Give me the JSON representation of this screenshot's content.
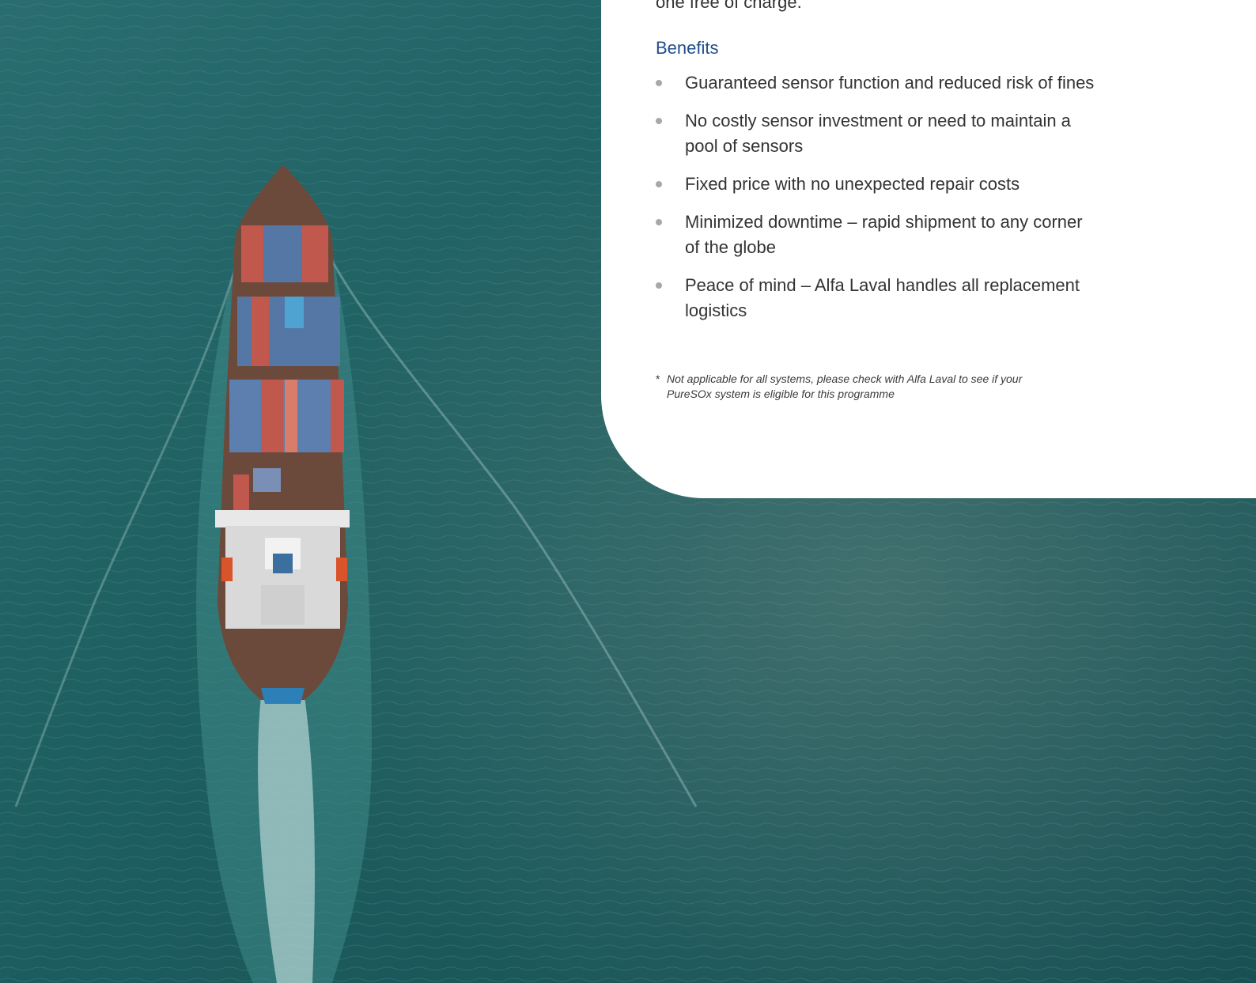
{
  "photo": {
    "subject": "container-ship-aerial"
  },
  "colors": {
    "sea": "#1d5e60",
    "card": "#ffffff",
    "heading": "#1f4e8c",
    "body_text": "#333333",
    "bullet": "#a7a8aa"
  },
  "intro": {
    "tail_text": "one free of charge."
  },
  "benefits": {
    "heading": "Benefits",
    "items": [
      {
        "text": "Guaranteed sensor function and reduced risk of fines"
      },
      {
        "text": "No costly sensor investment or need to maintain a pool of sensors"
      },
      {
        "text": "Fixed price with no unexpected repair costs"
      },
      {
        "text": "Minimized downtime – rapid shipment to any corner of the globe"
      },
      {
        "text": "Peace of mind – Alfa Laval handles all replacement logistics"
      }
    ]
  },
  "footnote": {
    "marker": "*",
    "text": "Not applicable for all systems, please check with Alfa Laval to see if your PureSOx system is eligible for this programme"
  }
}
